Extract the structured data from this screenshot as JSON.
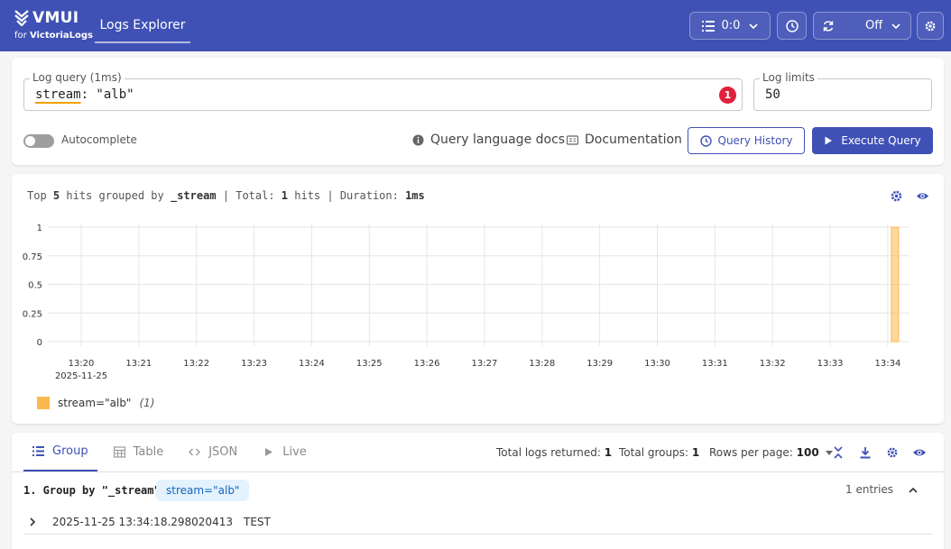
{
  "header": {
    "logo_name": "VMUI",
    "logo_sub_prefix": "for ",
    "logo_sub_brand": "VictoriaLogs",
    "nav_tab": "Logs Explorer",
    "tenant_value": "0:0",
    "refresh_value": "Off"
  },
  "query": {
    "label": "Log query (1ms)",
    "key": "stream",
    "value": ": \"alb\"",
    "error_count": "1",
    "limit_label": "Log limits",
    "limit_value": "50",
    "autocomplete_label": "Autocomplete",
    "docs_link": "Query language docs",
    "documentation_link": "Documentation",
    "history_button": "Query History",
    "execute_button": "Execute Query"
  },
  "summary": {
    "prefix": "Top ",
    "top": "5",
    "mid1": " hits grouped by ",
    "field": "_stream",
    "mid2": " | Total: ",
    "total": "1",
    "mid3": " hits | Duration: ",
    "duration": "1ms"
  },
  "chart_data": {
    "type": "bar",
    "x": [
      "13:20",
      "13:21",
      "13:22",
      "13:23",
      "13:24",
      "13:25",
      "13:26",
      "13:27",
      "13:28",
      "13:29",
      "13:30",
      "13:31",
      "13:32",
      "13:33",
      "13:34"
    ],
    "x_sub": "2025-11-25",
    "y_ticks": [
      "1",
      "0.75",
      "0.5",
      "0.25",
      "0"
    ],
    "ylim": [
      0,
      1
    ],
    "grid": true,
    "series": [
      {
        "name": "stream=\"alb\"",
        "count": "(1)",
        "color": "#fbb84d",
        "bars": [
          {
            "x": "13:34",
            "value": 1
          }
        ]
      }
    ]
  },
  "logs": {
    "tabs": [
      "Group",
      "Table",
      "JSON",
      "Live"
    ],
    "total_logs_label": "Total logs returned:",
    "total_logs": "1",
    "total_groups_label": "Total groups:",
    "total_groups": "1",
    "rows_per_page_label": "Rows per page:",
    "rows_per_page": "100",
    "group_title": "1. Group by \"_stream\":",
    "group_chip": "stream=\"alb\"",
    "entries": "1 entries",
    "row": {
      "time": "2025-11-25 13:34:18.298020413",
      "msg": "TEST"
    }
  },
  "colors": {
    "primary": "#3f51b5",
    "bar": "#fbb84d",
    "error": "#e0203c"
  }
}
